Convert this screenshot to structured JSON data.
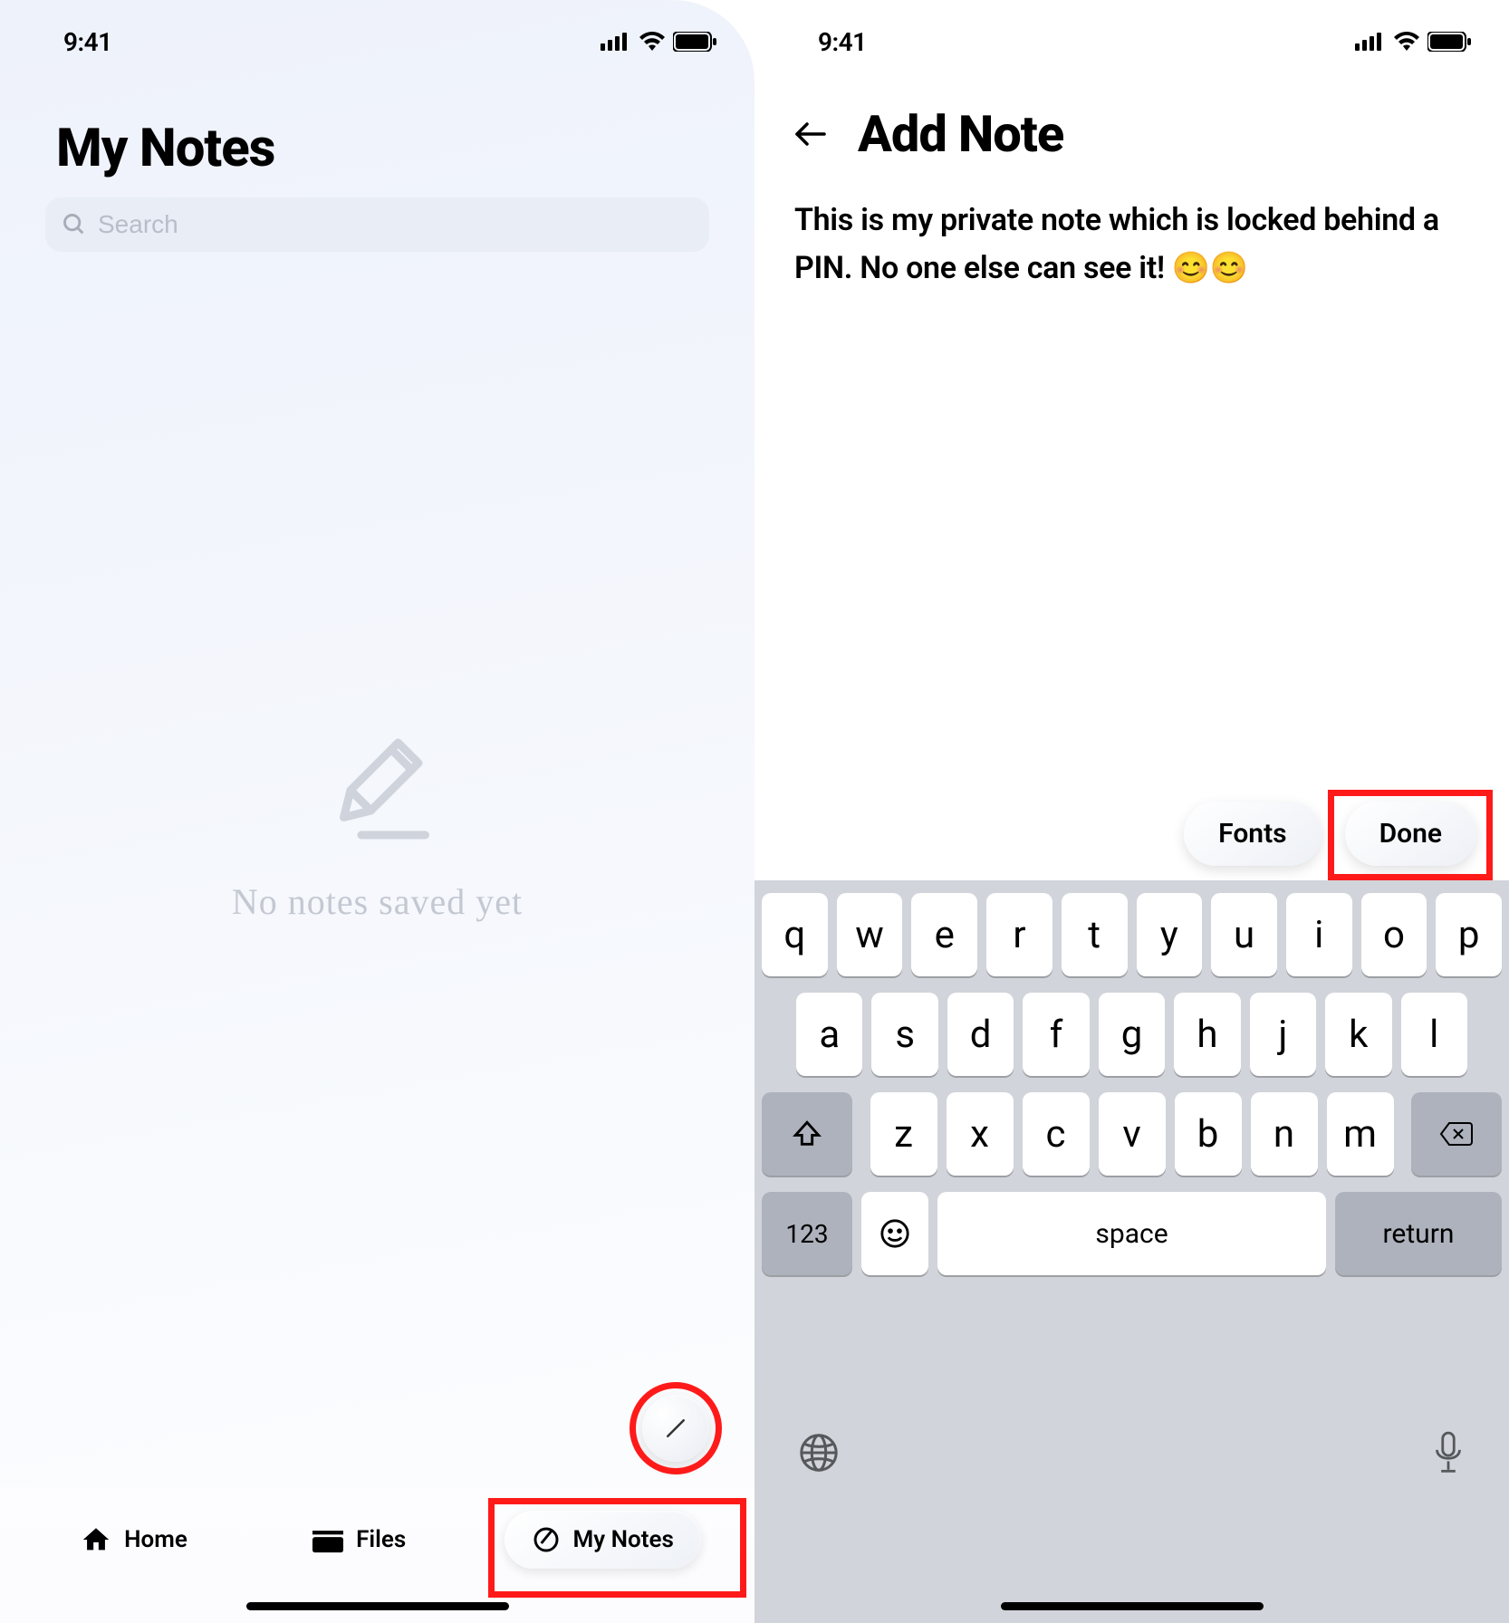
{
  "status": {
    "time": "9:41"
  },
  "left": {
    "title": "My Notes",
    "search_placeholder": "Search",
    "empty_text": "No notes saved yet",
    "tabs": {
      "home": "Home",
      "files": "Files",
      "notes": "My Notes"
    }
  },
  "right": {
    "title": "Add Note",
    "note_text": "This is my private note which is locked behind a PIN. No one else can see it! 😊😊",
    "fonts_label": "Fonts",
    "done_label": "Done"
  },
  "keyboard": {
    "row1": [
      "q",
      "w",
      "e",
      "r",
      "t",
      "y",
      "u",
      "i",
      "o",
      "p"
    ],
    "row2": [
      "a",
      "s",
      "d",
      "f",
      "g",
      "h",
      "j",
      "k",
      "l"
    ],
    "row3": [
      "z",
      "x",
      "c",
      "v",
      "b",
      "n",
      "m"
    ],
    "num": "123",
    "space": "space",
    "ret": "return"
  }
}
